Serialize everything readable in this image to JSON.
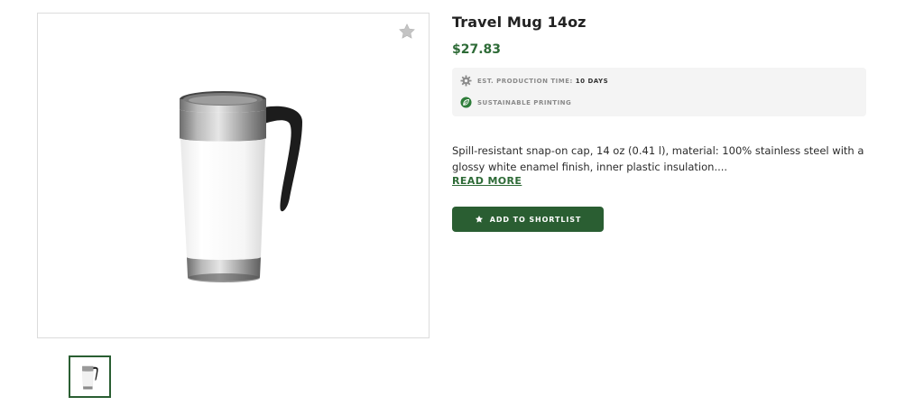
{
  "product": {
    "title": "Travel Mug 14oz",
    "price": "$27.83",
    "production_label": "EST. PRODUCTION TIME:",
    "production_value": "10 DAYS",
    "sustainable_label": "SUSTAINABLE PRINTING",
    "description": "Spill-resistant snap-on cap, 14 oz (0.41 l), material: 100% stainless steel with a glossy white enamel finish, inner plastic insulation....",
    "read_more": "READ MORE",
    "shortlist_button": "ADD TO SHORTLIST"
  },
  "icons": {
    "favorite": "star-icon",
    "production": "gear-icon",
    "sustainable": "leaf-icon",
    "button": "star-icon"
  },
  "colors": {
    "accent": "#2a5e32",
    "price": "#2e6b37",
    "info_bg": "#f4f4f4"
  }
}
